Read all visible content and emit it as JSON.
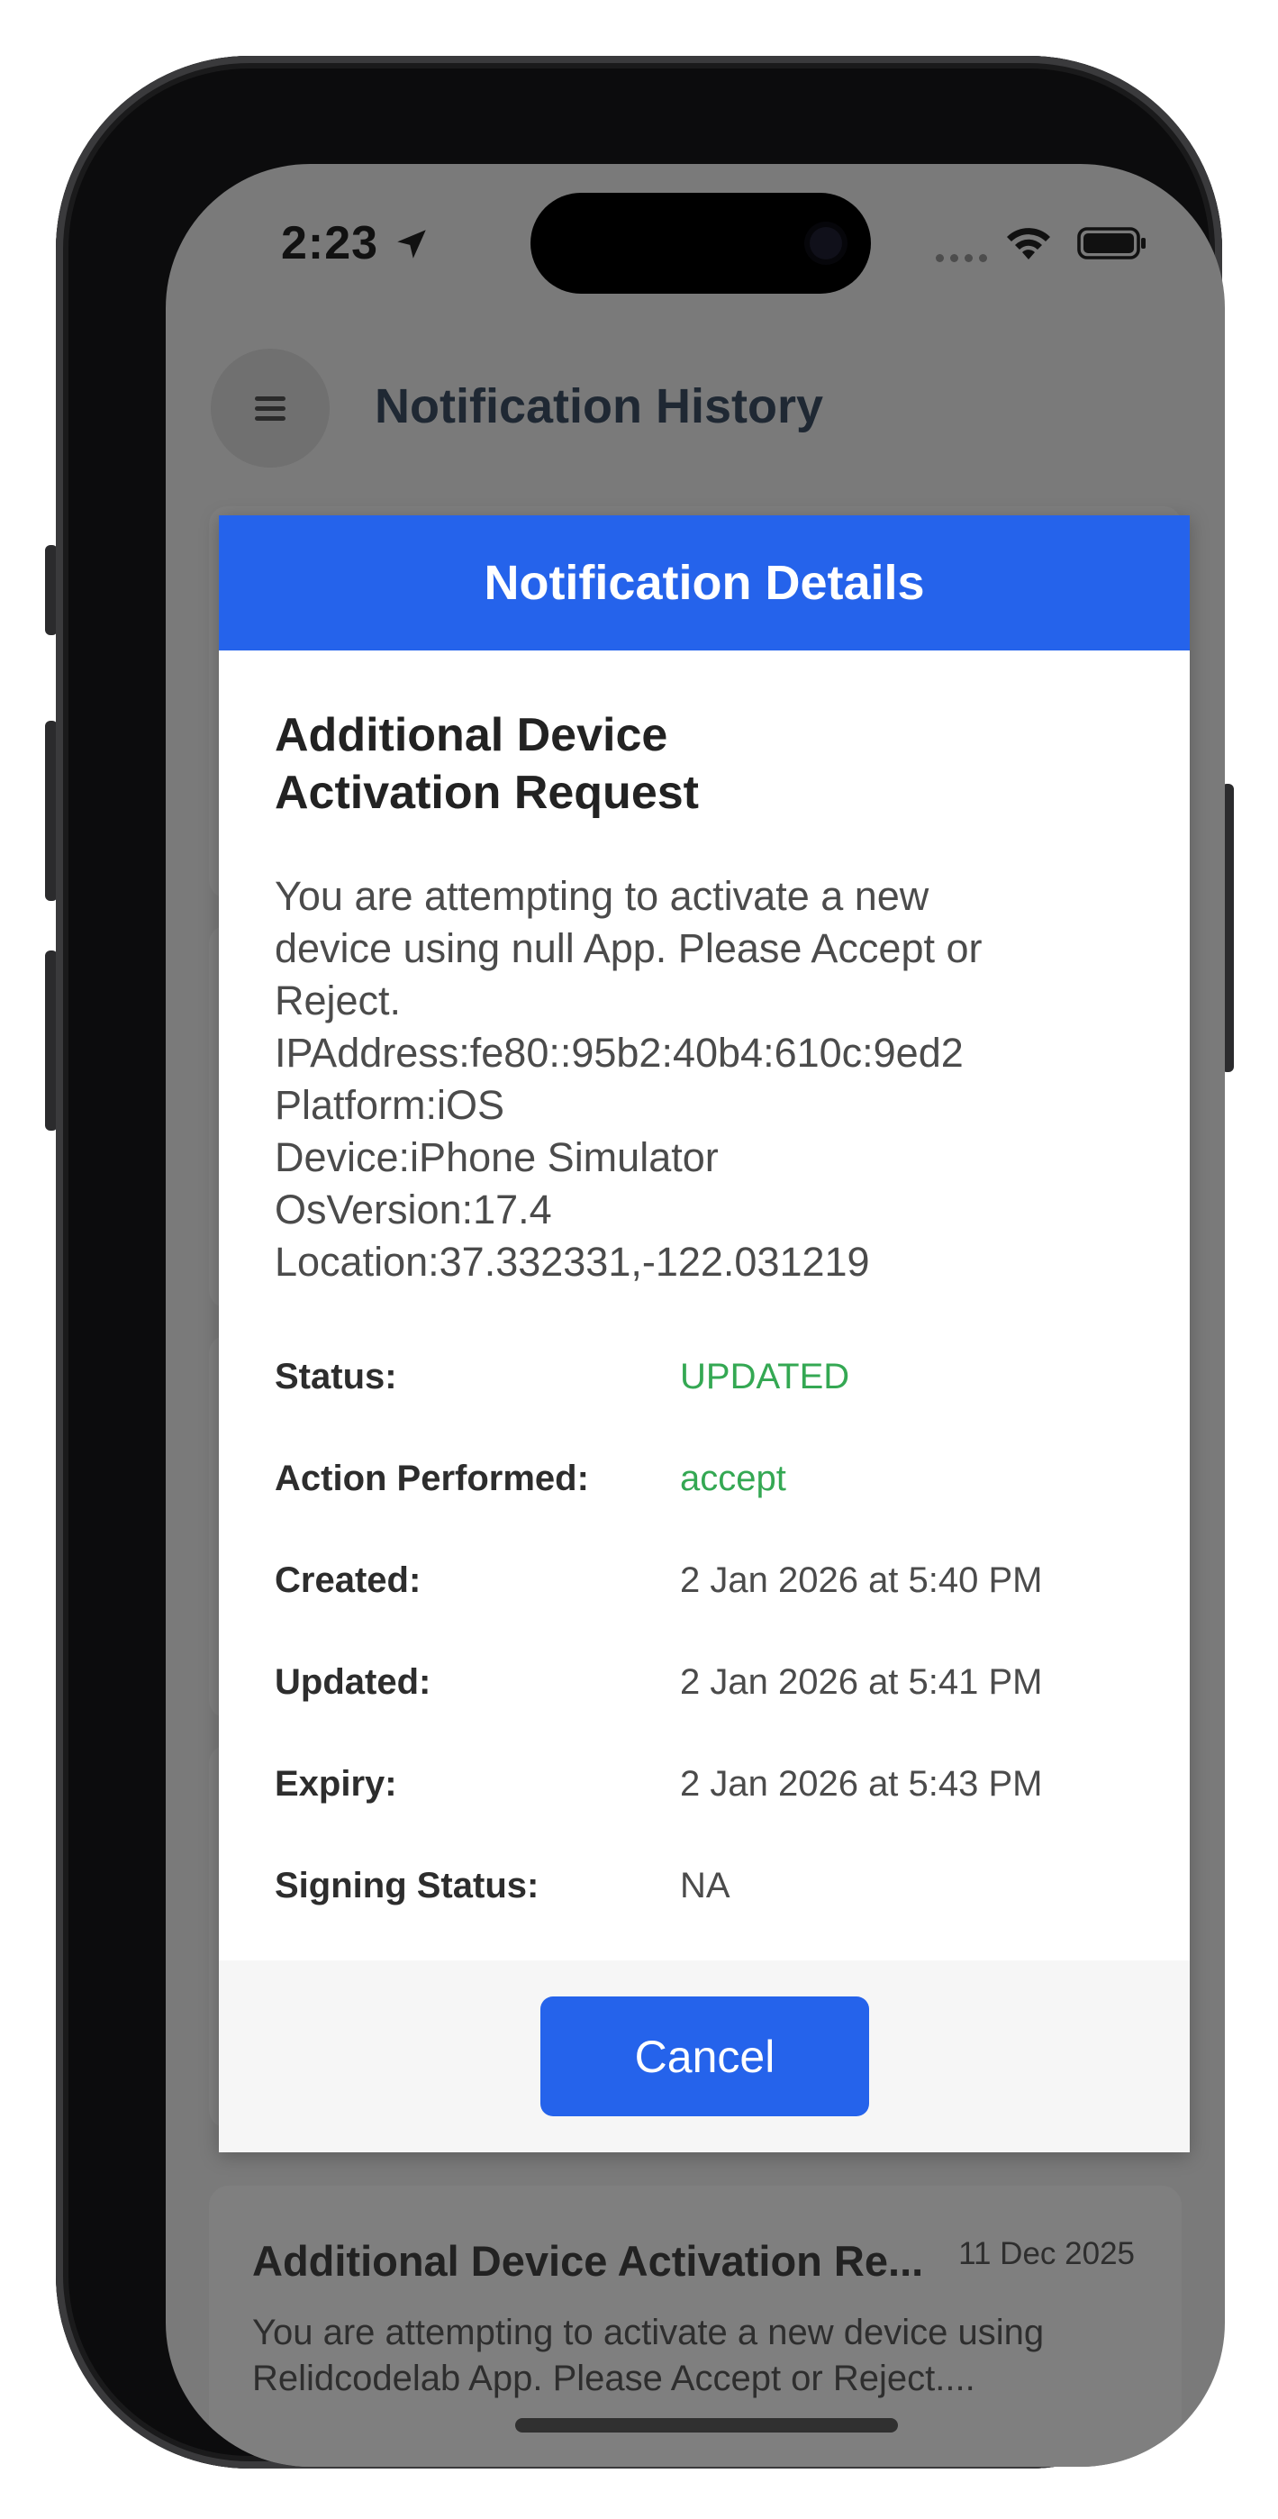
{
  "status_bar": {
    "time": "2:23"
  },
  "header": {
    "title": "Notification History"
  },
  "modal": {
    "header_title": "Notification Details",
    "notification_title": "Additional Device Activation Request",
    "message_lines": [
      "You are attempting to activate a new",
      "device using null App. Please Accept or",
      "Reject.",
      "IPAddress:fe80::95b2:40b4:610c:9ed2",
      "Platform:iOS",
      "Device:iPhone Simulator",
      "OsVersion:17.4",
      "Location:37.332331,-122.031219"
    ],
    "details": [
      {
        "label": "Status:",
        "value": "UPDATED",
        "color": "#34a853"
      },
      {
        "label": "Action Performed:",
        "value": "accept",
        "color": "#34a853"
      },
      {
        "label": "Created:",
        "value": "2 Jan 2026 at 5:40 PM"
      },
      {
        "label": "Updated:",
        "value": "2 Jan 2026 at 5:41 PM"
      },
      {
        "label": "Expiry:",
        "value": "2 Jan 2026 at 5:43 PM"
      },
      {
        "label": "Signing Status:",
        "value": "NA"
      }
    ],
    "cancel_label": "Cancel"
  },
  "list": {
    "items": [
      {
        "title": "Additional Device Activation Re...",
        "date": "11 Dec 2025",
        "body": "You are attempting to activate a new device using Relidcodelab App. Please Accept or Reject...."
      }
    ]
  },
  "colors": {
    "accent": "#2563eb",
    "status_green": "#34a853",
    "overlay": "#7a7a7a"
  }
}
